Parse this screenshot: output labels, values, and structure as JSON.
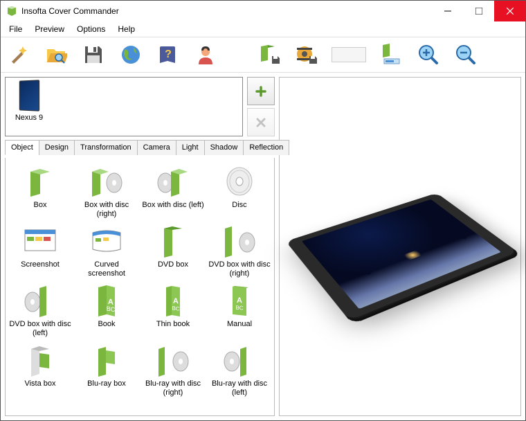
{
  "title": "Insofta Cover Commander",
  "menu": {
    "file": "File",
    "preview": "Preview",
    "options": "Options",
    "help": "Help"
  },
  "scene": {
    "item_label": "Nexus 9"
  },
  "tabs": {
    "object": "Object",
    "design": "Design",
    "transformation": "Transformation",
    "camera": "Camera",
    "light": "Light",
    "shadow": "Shadow",
    "reflection": "Reflection"
  },
  "gallery": {
    "box": "Box",
    "box_disc_right": "Box with disc (right)",
    "box_disc_left": "Box with disc (left)",
    "disc": "Disc",
    "screenshot": "Screenshot",
    "curved_screenshot": "Curved screenshot",
    "dvd_box": "DVD box",
    "dvd_box_disc_right": "DVD box with disc (right)",
    "dvd_box_disc_left": "DVD box with disc (left)",
    "book": "Book",
    "thin_book": "Thin book",
    "manual": "Manual",
    "vista_box": "Vista box",
    "bluray_box": "Blu-ray box",
    "bluray_disc_right": "Blu-ray with disc (right)",
    "bluray_disc_left": "Blu-ray with disc (left)"
  }
}
